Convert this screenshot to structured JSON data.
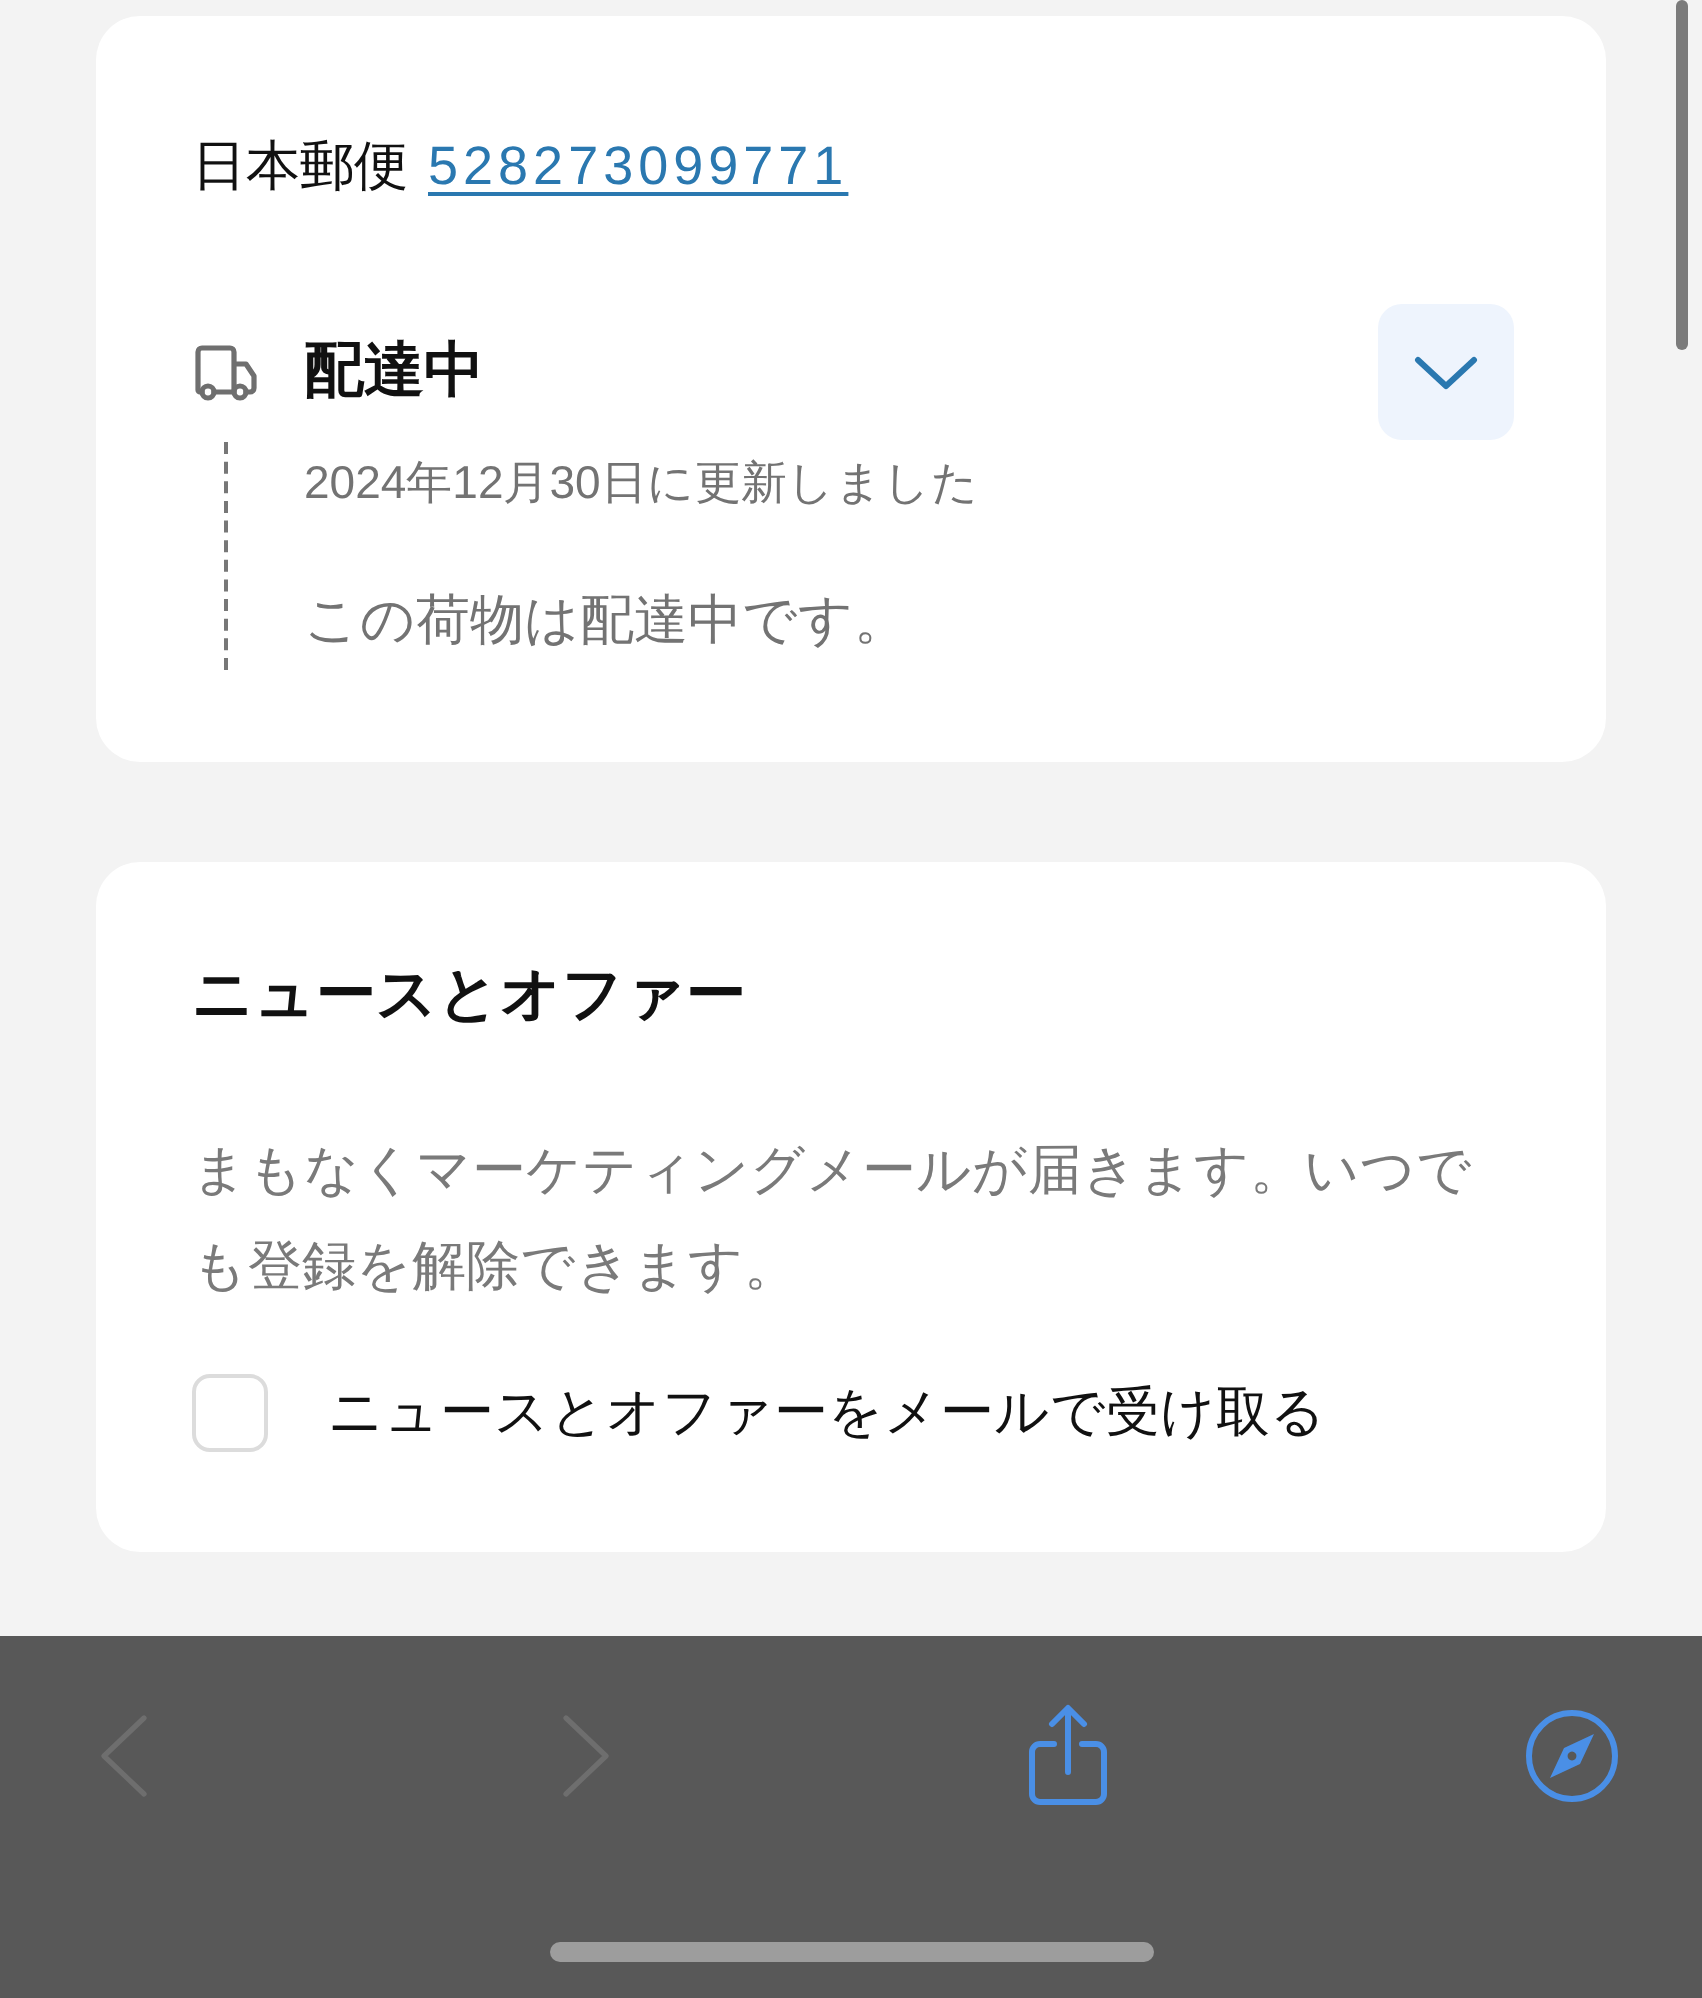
{
  "shipment": {
    "carrier": "日本郵便",
    "tracking_number": "528273099771",
    "status": "配達中",
    "expanded": false,
    "updated": "2024年12月30日に更新しました",
    "message": "この荷物は配達中です。"
  },
  "news": {
    "title": "ニュースとオファー",
    "description": "まもなくマーケティングメールが届きます。いつでも登録を解除できます。",
    "checkbox": {
      "label": "ニュースとオファーをメールで受け取る",
      "checked": false
    }
  },
  "toolbar": [
    {
      "kind": "back",
      "disabled": true
    },
    {
      "kind": "forward",
      "disabled": true
    },
    {
      "kind": "share",
      "disabled": false
    },
    {
      "kind": "compass",
      "disabled": false
    }
  ]
}
